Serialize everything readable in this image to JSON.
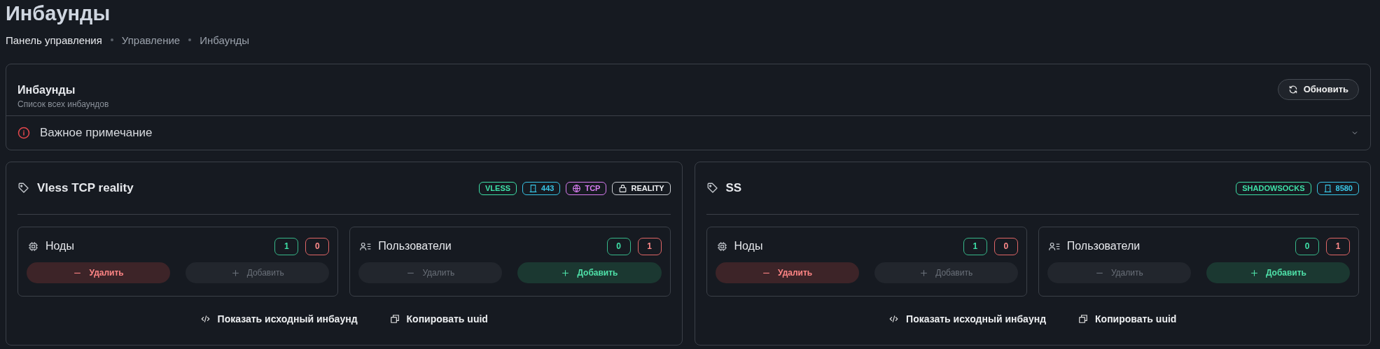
{
  "page_title": "Инбаунды",
  "breadcrumbs": [
    {
      "label": "Панель управления",
      "current": false
    },
    {
      "label": "Управление",
      "current": true
    },
    {
      "label": "Инбаунды",
      "current": true
    }
  ],
  "panel": {
    "title": "Инбаунды",
    "subtitle": "Список всех инбаундов",
    "refresh_button": "Обновить",
    "note": {
      "label": "Важное примечание",
      "expanded": false
    }
  },
  "inbounds": [
    {
      "name": "Vless TCP reality",
      "badges": [
        {
          "kind": "protocol",
          "text": "VLESS"
        },
        {
          "kind": "port",
          "text": "443"
        },
        {
          "kind": "network",
          "text": "TCP"
        },
        {
          "kind": "security",
          "text": "REALITY"
        }
      ],
      "sections": [
        {
          "kind": "nodes",
          "title": "Ноды",
          "counts": [
            {
              "kind": "enabled",
              "text": "1"
            },
            {
              "kind": "disabled",
              "text": "0"
            }
          ],
          "buttons": [
            {
              "kind": "remove",
              "label": "Удалить",
              "disabled": false
            },
            {
              "kind": "add",
              "label": "Добавить",
              "disabled": true
            }
          ]
        },
        {
          "kind": "users",
          "title": "Пользователи",
          "counts": [
            {
              "kind": "enabled",
              "text": "0"
            },
            {
              "kind": "disabled",
              "text": "1"
            }
          ],
          "buttons": [
            {
              "kind": "remove",
              "label": "Удалить",
              "disabled": true
            },
            {
              "kind": "add",
              "label": "Добавить",
              "disabled": false
            }
          ]
        }
      ],
      "actions": [
        {
          "kind": "code",
          "label": "Показать исходный инбаунд"
        },
        {
          "kind": "copy",
          "label": "Копировать uuid"
        }
      ]
    },
    {
      "name": "SS",
      "badges": [
        {
          "kind": "protocol",
          "text": "SHADOWSOCKS"
        },
        {
          "kind": "port",
          "text": "8580"
        }
      ],
      "sections": [
        {
          "kind": "nodes",
          "title": "Ноды",
          "counts": [
            {
              "kind": "enabled",
              "text": "1"
            },
            {
              "kind": "disabled",
              "text": "0"
            }
          ],
          "buttons": [
            {
              "kind": "remove",
              "label": "Удалить",
              "disabled": false
            },
            {
              "kind": "add",
              "label": "Добавить",
              "disabled": true
            }
          ]
        },
        {
          "kind": "users",
          "title": "Пользователи",
          "counts": [
            {
              "kind": "enabled",
              "text": "0"
            },
            {
              "kind": "disabled",
              "text": "1"
            }
          ],
          "buttons": [
            {
              "kind": "remove",
              "label": "Удалить",
              "disabled": true
            },
            {
              "kind": "add",
              "label": "Добавить",
              "disabled": false
            }
          ]
        }
      ],
      "actions": [
        {
          "kind": "code",
          "label": "Показать исходный инбаунд"
        },
        {
          "kind": "copy",
          "label": "Копировать uuid"
        }
      ]
    }
  ]
}
